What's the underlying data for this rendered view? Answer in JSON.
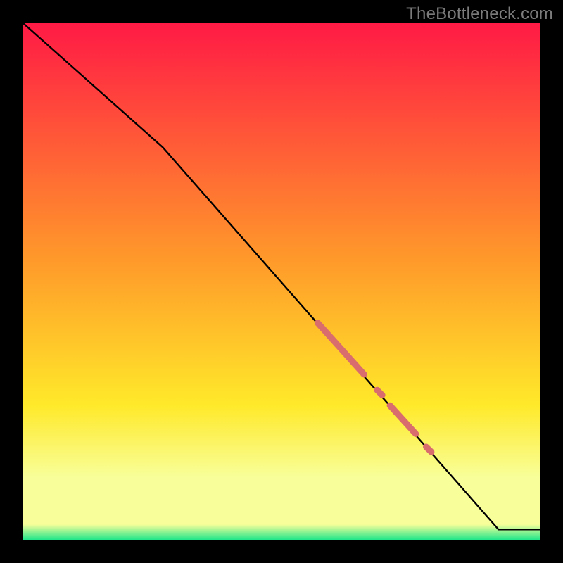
{
  "attribution": "TheBottleneck.com",
  "colors": {
    "red": "#ff1a45",
    "orange": "#ff9a2a",
    "yellow": "#ffe92a",
    "pale": "#f8ff9a",
    "green": "#20e68a",
    "line": "#000000",
    "marker": "#d96d6d",
    "bg": "#000000"
  },
  "chart_data": {
    "type": "line",
    "title": "",
    "xlabel": "",
    "ylabel": "",
    "xlim": [
      0,
      100
    ],
    "ylim": [
      0,
      100
    ],
    "series": [
      {
        "name": "curve",
        "x": [
          0,
          27,
          92,
          100
        ],
        "y": [
          100,
          76,
          2,
          2
        ]
      }
    ],
    "markers": [
      {
        "name": "seg-a",
        "x0": 57,
        "y0": 42,
        "x1": 66,
        "y1": 32,
        "w": 9
      },
      {
        "name": "dot-1",
        "x0": 68.5,
        "y0": 29,
        "x1": 69.5,
        "y1": 28,
        "w": 9
      },
      {
        "name": "seg-b",
        "x0": 71,
        "y0": 26,
        "x1": 76,
        "y1": 20.5,
        "w": 9
      },
      {
        "name": "dot-2",
        "x0": 78,
        "y0": 18,
        "x1": 79,
        "y1": 17,
        "w": 9
      }
    ]
  }
}
